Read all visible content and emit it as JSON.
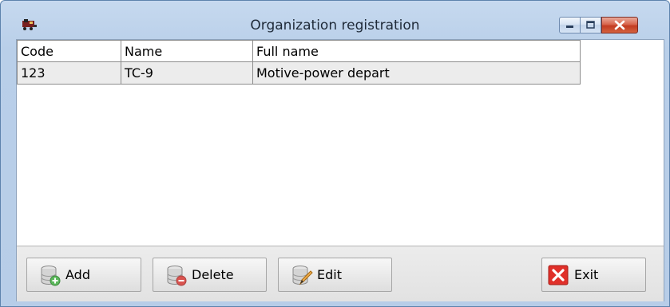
{
  "window": {
    "title": "Organization registration"
  },
  "table": {
    "columns": [
      "Code",
      "Name",
      "Full name"
    ],
    "rows": [
      [
        "123",
        "TC-9",
        "Motive-power depart"
      ]
    ]
  },
  "buttons": {
    "add": "Add",
    "delete": "Delete",
    "edit": "Edit",
    "exit": "Exit"
  },
  "icons": {
    "app": "locomotive-icon",
    "add": "database-add-icon",
    "delete": "database-remove-icon",
    "edit": "database-edit-icon",
    "exit": "close-icon"
  },
  "colors": {
    "exit_icon": "#e0302a",
    "add_icon": "#5cb85c",
    "delete_icon": "#d9534f"
  }
}
